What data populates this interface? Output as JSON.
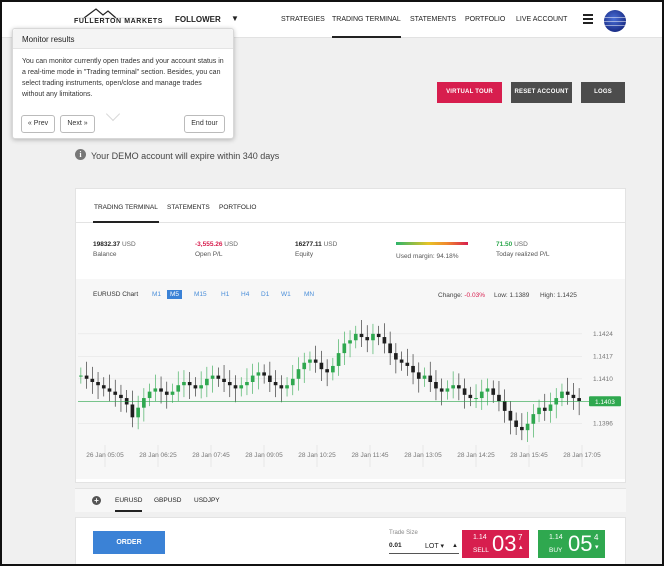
{
  "nav": {
    "logo_text": "FULLERTON MARKETS",
    "mode": "FOLLOWER",
    "items": [
      "STRATEGIES",
      "TRADING TERMINAL",
      "STATEMENTS",
      "PORTFOLIO",
      "LIVE ACCOUNT"
    ],
    "active": "TRADING TERMINAL"
  },
  "actions": {
    "virtual_tour": "VIRTUAL TOUR",
    "reset_account": "RESET ACCOUNT",
    "logs": "LOGS"
  },
  "tour": {
    "title": "Monitor results",
    "body": "You can monitor currently open trades and your account status in a real-time mode in \"Trading terminal\" section. Besides, you can select trading instruments, open/close and manage trades without any limitations.",
    "prev": "« Prev",
    "next": "Next »",
    "end": "End tour"
  },
  "demo_notice": "Your DEMO account will expire within 340 days",
  "panel_tabs": [
    "TRADING TERMINAL",
    "STATEMENTS",
    "PORTFOLIO"
  ],
  "stats": {
    "balance": {
      "value": "19832.37",
      "unit": "USD",
      "label": "Balance"
    },
    "open_pl": {
      "value": "-3,555.26",
      "unit": "USD",
      "label": "Open P/L"
    },
    "equity": {
      "value": "16277.11",
      "unit": "USD",
      "label": "Equity"
    },
    "used_margin": {
      "label": "Used margin: 94.18%",
      "fraction": 0.9418
    },
    "realized": {
      "value": "71.50",
      "unit": "USD",
      "label": "Today realized P/L"
    }
  },
  "chart_header": {
    "title": "EURUSD Chart",
    "timeframes": [
      "M1",
      "M5",
      "M15",
      "H1",
      "H4",
      "D1",
      "W1",
      "MN"
    ],
    "active_tf": "M5",
    "change_label": "Change:",
    "change_value": "-0.03%",
    "low": "Low: 1.1389",
    "high": "High: 1.1425"
  },
  "symbols": [
    "EURUSD",
    "GBPUSD",
    "USDJPY"
  ],
  "active_symbol": "EURUSD",
  "order": {
    "button": "ORDER",
    "trade_size_label": "Trade Size",
    "trade_size_value": "0.01",
    "unit": "LOT",
    "sell": {
      "prefix": "1.14",
      "side": "SELL",
      "big": "03",
      "sup": "7"
    },
    "buy": {
      "prefix": "1.14",
      "side": "BUY",
      "big": "05",
      "sup": "4"
    }
  },
  "colors": {
    "sell": "#d71e4e",
    "buy": "#2fa84f",
    "accent": "#3b82d6",
    "candle_up": "#2fa84f",
    "candle_down": "#1f1f1f"
  },
  "chart_data": {
    "type": "candlestick",
    "symbol": "EURUSD",
    "timeframe": "M5",
    "x_ticks": [
      "26 Jan 05:05",
      "28 Jan 06:25",
      "28 Jan 07:45",
      "28 Jan 09:05",
      "28 Jan 10:25",
      "28 Jan 11:45",
      "28 Jan 13:05",
      "28 Jan 14:25",
      "28 Jan 15:45",
      "28 Jan 17:05"
    ],
    "y_ticks": [
      "1.1424",
      "1.1417",
      "1.1410",
      "1.1403",
      "1.1396"
    ],
    "y_range": [
      1.139,
      1.1428
    ],
    "current_price": "1.1403",
    "close_series": [
      1.1411,
      1.141,
      1.1409,
      1.1408,
      1.1407,
      1.1406,
      1.1405,
      1.1404,
      1.1402,
      1.1398,
      1.1401,
      1.1404,
      1.1406,
      1.1407,
      1.1406,
      1.1405,
      1.1406,
      1.1408,
      1.1409,
      1.1408,
      1.1407,
      1.1408,
      1.141,
      1.1411,
      1.141,
      1.1409,
      1.1408,
      1.1407,
      1.1408,
      1.1409,
      1.1411,
      1.1412,
      1.1411,
      1.1409,
      1.1408,
      1.1407,
      1.1408,
      1.141,
      1.1413,
      1.1415,
      1.1416,
      1.1415,
      1.1413,
      1.1412,
      1.1414,
      1.1418,
      1.1421,
      1.1422,
      1.1424,
      1.1423,
      1.1422,
      1.1424,
      1.1423,
      1.1421,
      1.1418,
      1.1416,
      1.1415,
      1.1414,
      1.1412,
      1.141,
      1.1411,
      1.1409,
      1.1407,
      1.1406,
      1.1407,
      1.1408,
      1.1407,
      1.1405,
      1.1404,
      1.1404,
      1.1406,
      1.1407,
      1.1405,
      1.1403,
      1.14,
      1.1397,
      1.1395,
      1.1394,
      1.1396,
      1.1399,
      1.1401,
      1.14,
      1.1402,
      1.1404,
      1.1406,
      1.1405,
      1.1404,
      1.1403
    ]
  }
}
